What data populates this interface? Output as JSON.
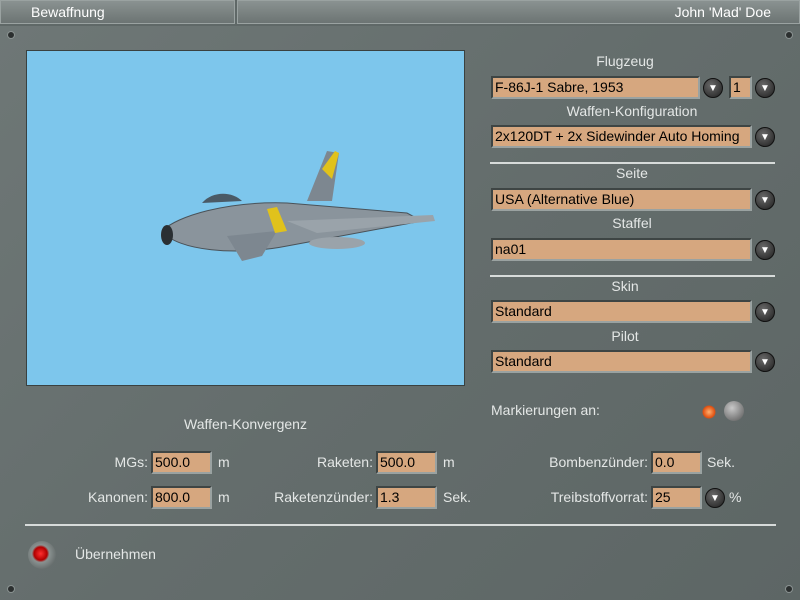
{
  "header": {
    "section": "Bewaffnung",
    "user": "John 'Mad' Doe"
  },
  "aircraft": {
    "label": "Flugzeug",
    "value": "F-86J-1 Sabre, 1953",
    "count": "1"
  },
  "loadout": {
    "label": "Waffen-Konfiguration",
    "value": "2x120DT + 2x Sidewinder Auto Homing"
  },
  "side": {
    "label": "Seite",
    "value": "USA (Alternative Blue)"
  },
  "squadron": {
    "label": "Staffel",
    "value": "na01"
  },
  "skin": {
    "label": "Skin",
    "value": "Standard"
  },
  "pilot": {
    "label": "Pilot",
    "value": "Standard"
  },
  "markings": {
    "label": "Markierungen an:",
    "enabled": true
  },
  "convergence": {
    "title": "Waffen-Konvergenz",
    "mgs": {
      "label": "MGs:",
      "value": "500.0",
      "unit": "m"
    },
    "cannons": {
      "label": "Kanonen:",
      "value": "800.0",
      "unit": "m"
    },
    "rockets": {
      "label": "Raketen:",
      "value": "500.0",
      "unit": "m"
    },
    "rocket_fuze": {
      "label": "Raketenzünder:",
      "value": "1.3",
      "unit": "Sek."
    },
    "bomb_fuze": {
      "label": "Bombenzünder:",
      "value": "0.0",
      "unit": "Sek."
    },
    "fuel": {
      "label": "Treibstoffvorrat:",
      "value": "25",
      "unit": "%"
    }
  },
  "apply": {
    "label": "Übernehmen"
  },
  "colors": {
    "field": "#d6a77f",
    "preview": "#7dc6ec"
  }
}
